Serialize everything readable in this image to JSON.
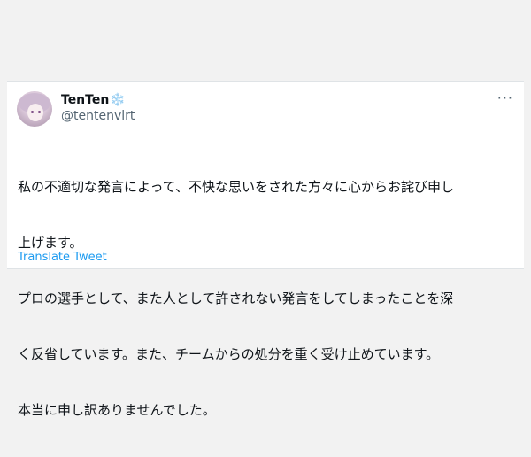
{
  "tweet": {
    "display_name": "TenTen",
    "name_badge": "❄️",
    "handle": "@tentenvlrt",
    "more_icon": "more-horizontal-icon",
    "body_lines": [
      "私の不適切な発言によって、不快な思いをされた方々に心からお詫び申し",
      "上げます。",
      "プロの選手として、また人として許されない発言をしてしまったことを深",
      "く反省しています。また、チームからの処分を重く受け止めています。",
      "本当に申し訳ありませんでした。"
    ],
    "translate_label": "Translate Tweet"
  },
  "colors": {
    "link": "#1d9bf0",
    "secondary_text": "#536471",
    "primary_text": "#0f1419",
    "background": "#f2f2f2"
  }
}
